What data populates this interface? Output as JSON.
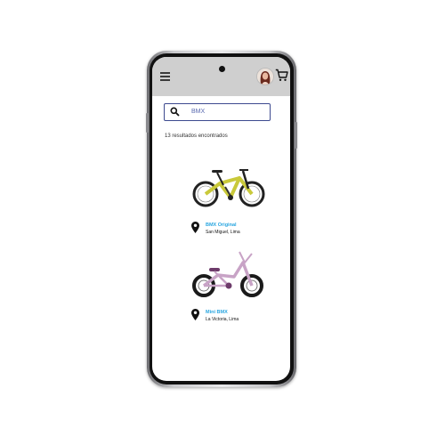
{
  "search": {
    "value": "BMX"
  },
  "results_text": "13 resultados encontrados",
  "products": [
    {
      "name": "BMX Original",
      "location": "San Miguel, Lima",
      "frame_color": "#c9c93a"
    },
    {
      "name": "Mini BMX",
      "location": "La Victoria, Lima",
      "frame_color": "#c8a3c6"
    }
  ],
  "icons": [
    "menu-icon",
    "avatar",
    "cart-icon",
    "search-icon",
    "location-pin-icon"
  ],
  "colors": {
    "topbar": "#cfcfcf",
    "link": "#2aa6e0",
    "search_border": "#3d4a8f"
  }
}
